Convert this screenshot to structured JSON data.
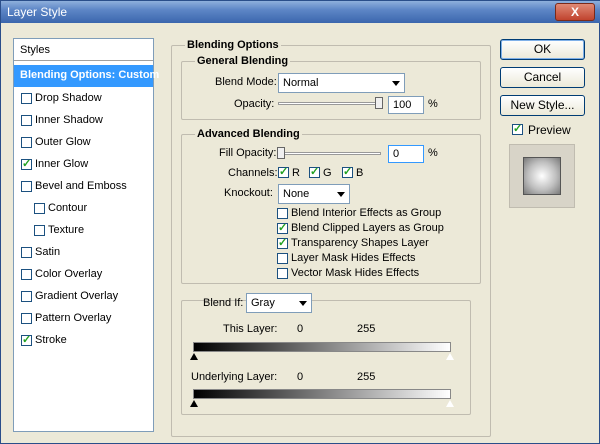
{
  "window": {
    "title": "Layer Style",
    "close": "X"
  },
  "styles": {
    "header": "Styles",
    "items": [
      {
        "label": "Blending Options: Custom",
        "checked": null,
        "selected": true
      },
      {
        "label": "Drop Shadow",
        "checked": false
      },
      {
        "label": "Inner Shadow",
        "checked": false
      },
      {
        "label": "Outer Glow",
        "checked": false
      },
      {
        "label": "Inner Glow",
        "checked": true
      },
      {
        "label": "Bevel and Emboss",
        "checked": false
      },
      {
        "label": "Contour",
        "checked": false
      },
      {
        "label": "Texture",
        "checked": false
      },
      {
        "label": "Satin",
        "checked": false
      },
      {
        "label": "Color Overlay",
        "checked": false
      },
      {
        "label": "Gradient Overlay",
        "checked": false
      },
      {
        "label": "Pattern Overlay",
        "checked": false
      },
      {
        "label": "Stroke",
        "checked": true
      }
    ]
  },
  "blending": {
    "title": "Blending Options",
    "general": {
      "title": "General Blending",
      "blend_mode_label": "Blend Mode:",
      "blend_mode": "Normal",
      "opacity_label": "Opacity:",
      "opacity": "100",
      "opacity_unit": "%"
    },
    "advanced": {
      "title": "Advanced Blending",
      "fill_opacity_label": "Fill Opacity:",
      "fill_opacity": "0",
      "fill_unit": "%",
      "channels_label": "Channels:",
      "channels": [
        "R",
        "G",
        "B"
      ],
      "knockout_label": "Knockout:",
      "knockout": "None",
      "options": [
        {
          "label": "Blend Interior Effects as Group",
          "checked": false
        },
        {
          "label": "Blend Clipped Layers as Group",
          "checked": true
        },
        {
          "label": "Transparency Shapes Layer",
          "checked": true
        },
        {
          "label": "Layer Mask Hides Effects",
          "checked": false
        },
        {
          "label": "Vector Mask Hides Effects",
          "checked": false
        }
      ]
    },
    "blend_if": {
      "label": "Blend If:",
      "value": "Gray",
      "this_layer_label": "This Layer:",
      "this_low": "0",
      "this_high": "255",
      "underlying_label": "Underlying Layer:",
      "under_low": "0",
      "under_high": "255"
    }
  },
  "buttons": {
    "ok": "OK",
    "cancel": "Cancel",
    "new_style": "New Style...",
    "preview_label": "Preview"
  }
}
